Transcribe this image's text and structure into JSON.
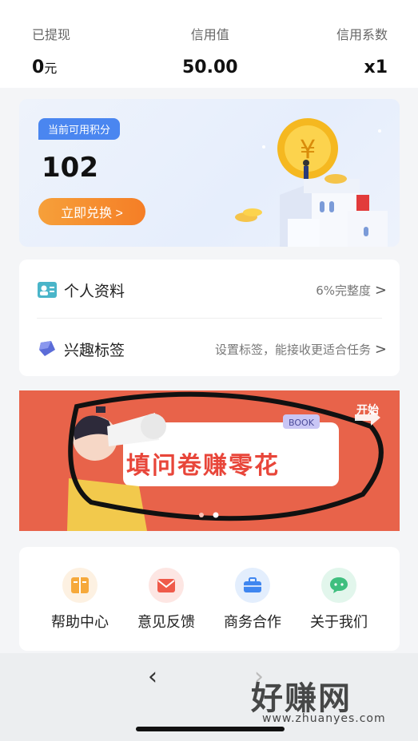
{
  "stats": [
    {
      "label": "已提现",
      "value": "0",
      "unit": "元"
    },
    {
      "label": "信用值",
      "value": "50.00"
    },
    {
      "label": "信用系数",
      "value": "x1"
    }
  ],
  "points": {
    "badge": "当前可用积分",
    "value": "102",
    "button": "立即兑换 >"
  },
  "profile": [
    {
      "title": "个人资料",
      "hint": "6%完整度",
      "icon": "profile-card-icon"
    },
    {
      "title": "兴趣标签",
      "hint": "设置标签，能接收更适合任务",
      "icon": "tag-icon"
    }
  ],
  "banner": {
    "text": "填问卷赚零花",
    "start": "开始",
    "sign": "BOOK"
  },
  "menu": [
    {
      "label": "帮助中心",
      "icon": "book-icon",
      "color": "#f6a93b",
      "bg": "#fdf1e2"
    },
    {
      "label": "意见反馈",
      "icon": "envelope-icon",
      "color": "#ef5a4a",
      "bg": "#fde6e3"
    },
    {
      "label": "商务合作",
      "icon": "briefcase-icon",
      "color": "#3f86f0",
      "bg": "#e3eefd"
    },
    {
      "label": "关于我们",
      "icon": "chat-icon",
      "color": "#3fbf7f",
      "bg": "#e2f6ec"
    }
  ],
  "nav": {
    "back": "‹",
    "forward": "›"
  },
  "watermark": {
    "logo": "好赚网",
    "url": "www.zhuanyes.com"
  }
}
